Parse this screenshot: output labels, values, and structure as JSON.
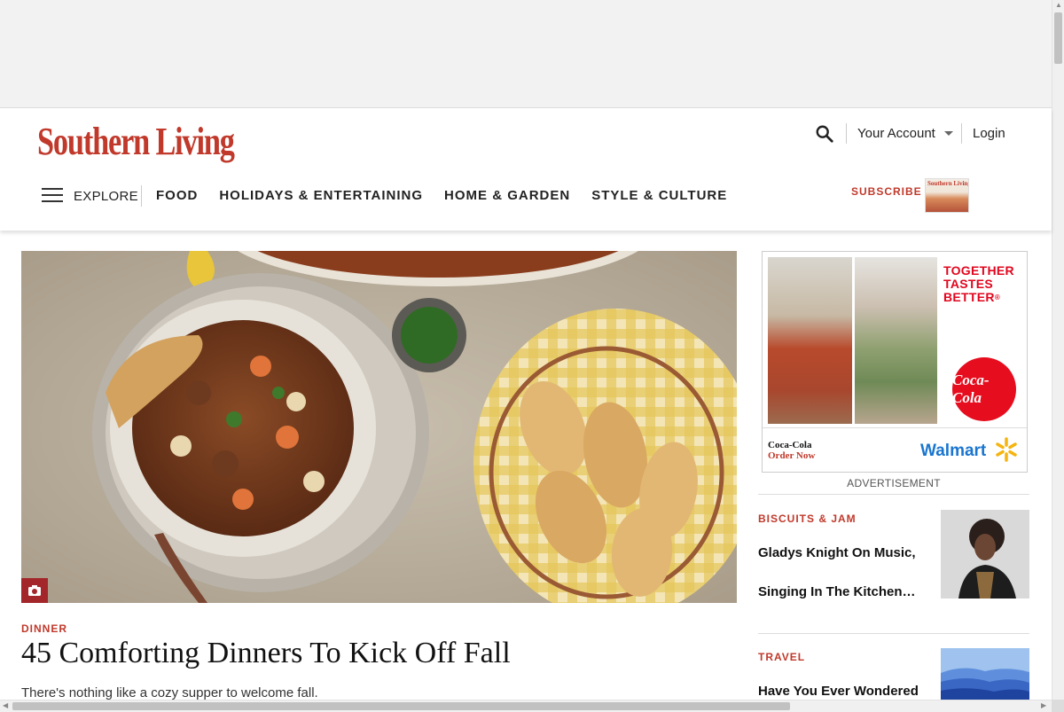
{
  "brand": {
    "logo_text": "Southern Living",
    "accent_color": "#c0392b"
  },
  "header": {
    "account_label": "Your Account",
    "login_label": "Login",
    "explore_label": "EXPLORE",
    "nav_items": [
      "FOOD",
      "HOLIDAYS & ENTERTAINING",
      "HOME & GARDEN",
      "STYLE & CULTURE"
    ],
    "subscribe_label": "SUBSCRIBE",
    "magazine_cover_title": "Southern Living"
  },
  "hero": {
    "category": "DINNER",
    "title": "45 Comforting Dinners To Kick Off Fall",
    "dek": "There's nothing like a cozy supper to welcome fall."
  },
  "ad": {
    "headline_lines": [
      "TOGETHER",
      "TASTES",
      "BETTER"
    ],
    "trademark": "®",
    "logo_text": "Coca-Cola",
    "brand_line": "Coca-Cola",
    "cta": "Order Now",
    "retailer": "Walmart",
    "label": "ADVERTISEMENT"
  },
  "sidebar_stories": [
    {
      "category": "BISCUITS & JAM",
      "title": "Gladys Knight On Music, Singing In The Kitchen…"
    },
    {
      "category": "TRAVEL",
      "title": "Have You Ever Wondered"
    }
  ],
  "icons": {
    "search": "search-icon",
    "menu": "hamburger-menu-icon",
    "camera": "camera-icon",
    "dropdown": "chevron-down-icon"
  }
}
